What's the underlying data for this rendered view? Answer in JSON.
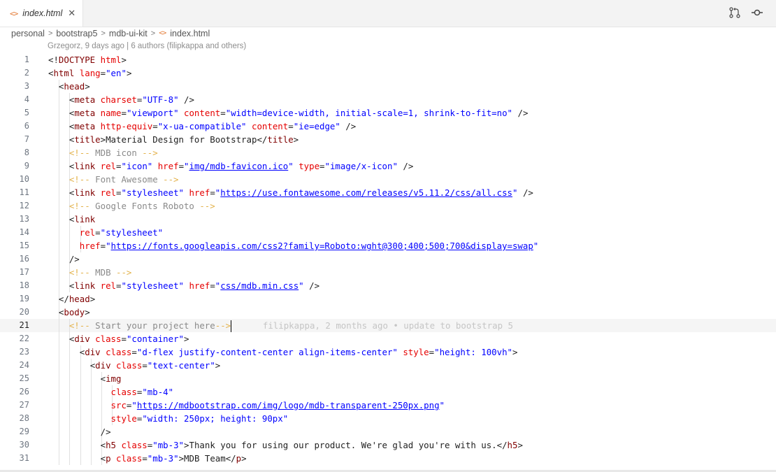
{
  "tab": {
    "icon": "html-code-icon",
    "label": "index.html"
  },
  "toolbar": {
    "actions": [
      "source-control-icon",
      "git-commit-icon"
    ]
  },
  "breadcrumb": [
    "personal",
    "bootstrap5",
    "mdb-ui-kit",
    "index.html"
  ],
  "blame": "Grzegorz, 9 days ago | 6 authors (filipkappa and others)",
  "current_line": 21,
  "inline_blame": "filipkappa, 2 months ago • update to bootstrap 5",
  "colors": {
    "tag": "#800000",
    "attribute": "#e50000",
    "string": "#0000ff",
    "comment": "#e3b24a"
  },
  "lines": [
    {
      "n": 1,
      "text": "<!DOCTYPE html>"
    },
    {
      "n": 2,
      "text": "<html lang=\"en\">"
    },
    {
      "n": 3,
      "text": "  <head>"
    },
    {
      "n": 4,
      "text": "    <meta charset=\"UTF-8\" />"
    },
    {
      "n": 5,
      "text": "    <meta name=\"viewport\" content=\"width=device-width, initial-scale=1, shrink-to-fit=no\" />"
    },
    {
      "n": 6,
      "text": "    <meta http-equiv=\"x-ua-compatible\" content=\"ie=edge\" />"
    },
    {
      "n": 7,
      "text": "    <title>Material Design for Bootstrap</title>"
    },
    {
      "n": 8,
      "text": "    <!-- MDB icon -->"
    },
    {
      "n": 9,
      "text": "    <link rel=\"icon\" href=\"img/mdb-favicon.ico\" type=\"image/x-icon\" />"
    },
    {
      "n": 10,
      "text": "    <!-- Font Awesome -->"
    },
    {
      "n": 11,
      "text": "    <link rel=\"stylesheet\" href=\"https://use.fontawesome.com/releases/v5.11.2/css/all.css\" />"
    },
    {
      "n": 12,
      "text": "    <!-- Google Fonts Roboto -->"
    },
    {
      "n": 13,
      "text": "    <link"
    },
    {
      "n": 14,
      "text": "      rel=\"stylesheet\""
    },
    {
      "n": 15,
      "text": "      href=\"https://fonts.googleapis.com/css2?family=Roboto:wght@300;400;500;700&display=swap\""
    },
    {
      "n": 16,
      "text": "    />"
    },
    {
      "n": 17,
      "text": "    <!-- MDB -->"
    },
    {
      "n": 18,
      "text": "    <link rel=\"stylesheet\" href=\"css/mdb.min.css\" />"
    },
    {
      "n": 19,
      "text": "  </head>"
    },
    {
      "n": 20,
      "text": "  <body>"
    },
    {
      "n": 21,
      "text": "    <!-- Start your project here-->"
    },
    {
      "n": 22,
      "text": "    <div class=\"container\">"
    },
    {
      "n": 23,
      "text": "      <div class=\"d-flex justify-content-center align-items-center\" style=\"height: 100vh\">"
    },
    {
      "n": 24,
      "text": "        <div class=\"text-center\">"
    },
    {
      "n": 25,
      "text": "          <img"
    },
    {
      "n": 26,
      "text": "            class=\"mb-4\""
    },
    {
      "n": 27,
      "text": "            src=\"https://mdbootstrap.com/img/logo/mdb-transparent-250px.png\""
    },
    {
      "n": 28,
      "text": "            style=\"width: 250px; height: 90px\""
    },
    {
      "n": 29,
      "text": "          />"
    },
    {
      "n": 30,
      "text": "          <h5 class=\"mb-3\">Thank you for using our product. We're glad you're with us.</h5>"
    },
    {
      "n": 31,
      "text": "          <p class=\"mb-3\">MDB Team</p>"
    }
  ]
}
